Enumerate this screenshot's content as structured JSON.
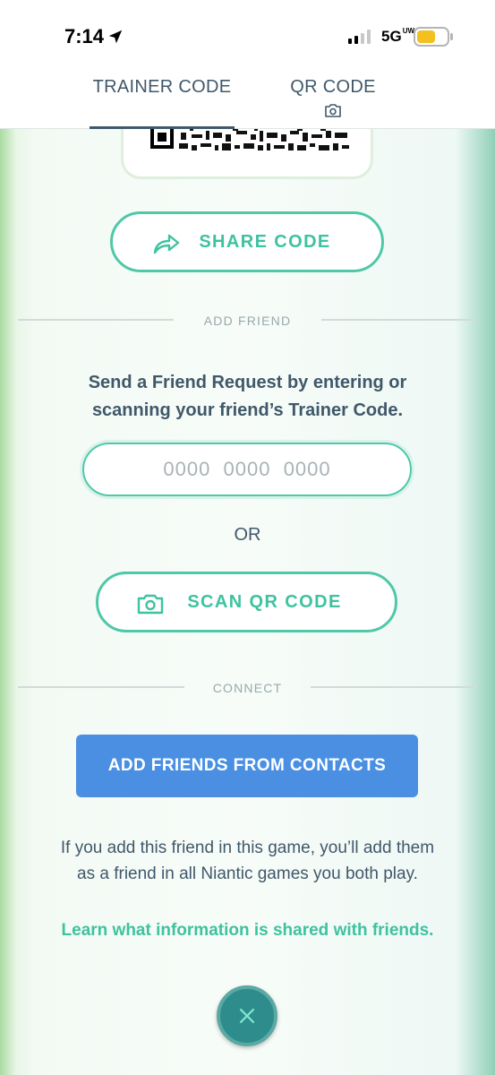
{
  "status_bar": {
    "time": "7:14",
    "network": "5G",
    "network_superscript": "UW"
  },
  "tabs": [
    {
      "label": "TRAINER CODE",
      "active": true
    },
    {
      "label": "QR CODE",
      "icon": "camera-icon"
    }
  ],
  "share_button": {
    "label": "SHARE CODE",
    "icon": "share-arrow-icon"
  },
  "add_friend": {
    "section_label": "ADD FRIEND",
    "instructions_line1": "Send a Friend Request by entering or",
    "instructions_line2": "scanning your friend’s Trainer Code.",
    "input_placeholder": "0000  0000  0000",
    "or_label": "OR",
    "scan_button_label": "SCAN QR CODE"
  },
  "connect": {
    "section_label": "CONNECT",
    "contacts_button_label": "ADD FRIENDS FROM CONTACTS",
    "note_line1": "If you add this friend in this game, you’ll add them",
    "note_line2": "as a friend in all Niantic games you both play.",
    "learn_link": "Learn what information is shared with friends."
  },
  "colors": {
    "accent_teal": "#3ec2a0",
    "text_dark": "#40586a",
    "contacts_blue": "#4a8fe2",
    "close_button": "#2e8d8c"
  }
}
